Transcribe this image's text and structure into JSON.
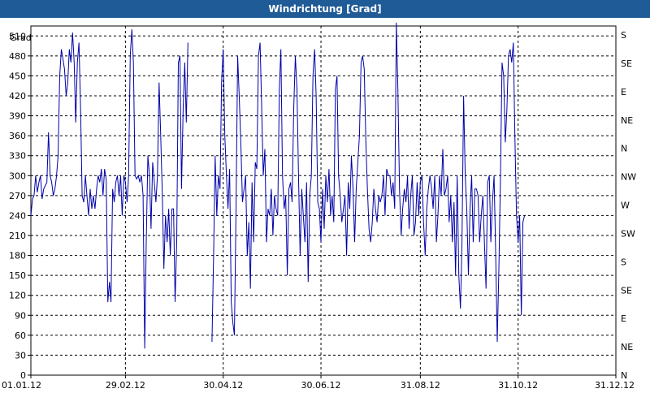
{
  "window": {
    "title": "Windrichtung [Grad]"
  },
  "chart_data": {
    "type": "line",
    "title": "Windrichtung [Grad]",
    "ylabel": "Grad",
    "xlabel": "",
    "ylim": [
      0,
      525
    ],
    "y_ticks": [
      0,
      30,
      60,
      90,
      120,
      150,
      180,
      210,
      240,
      270,
      300,
      330,
      360,
      390,
      420,
      450,
      480,
      510
    ],
    "x_ticks": [
      "01.01.12",
      "29.02.12",
      "30.04.12",
      "30.06.12",
      "31.08.12",
      "31.10.12",
      "31.12.12"
    ],
    "x_tick_days": [
      0,
      59,
      120,
      181,
      243,
      304,
      365
    ],
    "right_ticks": [
      {
        "label": "N",
        "deg": 0
      },
      {
        "label": "NE",
        "deg": 30
      },
      {
        "label": "E",
        "deg": 60
      },
      {
        "label": "SE",
        "deg": 90
      },
      {
        "label": "S",
        "deg": 120
      },
      {
        "label": "SW",
        "deg": 150
      },
      {
        "label": "W",
        "deg": 180
      },
      {
        "label": "NW",
        "deg": 210
      },
      {
        "label": "N",
        "deg": 240
      },
      {
        "label": "NE",
        "deg": 270
      },
      {
        "label": "E",
        "deg": 300
      },
      {
        "label": "SE",
        "deg": 330
      },
      {
        "label": "S",
        "deg": 360
      }
    ],
    "grid": true,
    "series": [
      {
        "name": "",
        "color": "#0000aa",
        "points": [
          [
            0,
            240
          ],
          [
            1,
            265
          ],
          [
            2,
            270
          ],
          [
            3,
            300
          ],
          [
            4,
            275
          ],
          [
            5,
            290
          ],
          [
            6,
            300
          ],
          [
            7,
            265
          ],
          [
            8,
            280
          ],
          [
            10,
            290
          ],
          [
            11,
            365
          ],
          [
            12,
            300
          ],
          [
            13,
            290
          ],
          [
            14,
            270
          ],
          [
            15,
            280
          ],
          [
            16,
            300
          ],
          [
            17,
            330
          ],
          [
            18,
            450
          ],
          [
            19,
            490
          ],
          [
            20,
            475
          ],
          [
            21,
            460
          ],
          [
            22,
            420
          ],
          [
            23,
            440
          ],
          [
            24,
            490
          ],
          [
            25,
            470
          ],
          [
            26,
            515
          ],
          [
            27,
            470
          ],
          [
            28,
            380
          ],
          [
            29,
            470
          ],
          [
            30,
            500
          ],
          [
            31,
            400
          ],
          [
            32,
            270
          ],
          [
            33,
            260
          ],
          [
            34,
            300
          ],
          [
            35,
            270
          ],
          [
            36,
            240
          ],
          [
            37,
            280
          ],
          [
            38,
            250
          ],
          [
            39,
            270
          ],
          [
            40,
            250
          ],
          [
            41,
            280
          ],
          [
            42,
            300
          ],
          [
            43,
            290
          ],
          [
            44,
            310
          ],
          [
            45,
            270
          ],
          [
            46,
            310
          ],
          [
            47,
            295
          ],
          [
            48,
            110
          ],
          [
            49,
            140
          ],
          [
            50,
            110
          ],
          [
            51,
            280
          ],
          [
            52,
            260
          ],
          [
            53,
            290
          ],
          [
            54,
            300
          ],
          [
            55,
            270
          ],
          [
            56,
            300
          ],
          [
            57,
            240
          ],
          [
            58,
            300
          ],
          [
            59,
            290
          ],
          [
            60,
            260
          ],
          [
            61,
            300
          ],
          [
            62,
            480
          ],
          [
            63,
            520
          ],
          [
            64,
            470
          ],
          [
            65,
            300
          ],
          [
            66,
            295
          ],
          [
            67,
            300
          ],
          [
            68,
            290
          ],
          [
            69,
            300
          ],
          [
            70,
            270
          ],
          [
            71,
            40
          ],
          [
            72,
            200
          ],
          [
            73,
            330
          ],
          [
            74,
            300
          ],
          [
            75,
            220
          ],
          [
            76,
            320
          ],
          [
            77,
            290
          ],
          [
            78,
            260
          ],
          [
            79,
            300
          ],
          [
            80,
            440
          ],
          [
            81,
            360
          ],
          [
            82,
            270
          ],
          [
            83,
            160
          ],
          [
            84,
            240
          ],
          [
            85,
            200
          ],
          [
            86,
            250
          ],
          [
            87,
            180
          ],
          [
            88,
            250
          ],
          [
            89,
            250
          ],
          [
            90,
            110
          ],
          [
            91,
            200
          ],
          [
            92,
            470
          ],
          [
            93,
            480
          ],
          [
            94,
            280
          ],
          [
            95,
            400
          ],
          [
            96,
            470
          ],
          [
            97,
            380
          ],
          [
            98,
            500
          ],
          [
            113,
            50
          ],
          [
            114,
            180
          ],
          [
            115,
            330
          ],
          [
            116,
            240
          ],
          [
            117,
            300
          ],
          [
            118,
            280
          ],
          [
            119,
            440
          ],
          [
            120,
            490
          ],
          [
            121,
            360
          ],
          [
            122,
            300
          ],
          [
            123,
            250
          ],
          [
            124,
            310
          ],
          [
            125,
            110
          ],
          [
            126,
            80
          ],
          [
            127,
            60
          ],
          [
            128,
            250
          ],
          [
            129,
            480
          ],
          [
            130,
            420
          ],
          [
            131,
            350
          ],
          [
            132,
            260
          ],
          [
            133,
            280
          ],
          [
            134,
            300
          ],
          [
            135,
            180
          ],
          [
            136,
            230
          ],
          [
            137,
            130
          ],
          [
            138,
            290
          ],
          [
            139,
            200
          ],
          [
            140,
            320
          ],
          [
            141,
            310
          ],
          [
            142,
            480
          ],
          [
            143,
            500
          ],
          [
            144,
            400
          ],
          [
            145,
            300
          ],
          [
            146,
            340
          ],
          [
            147,
            200
          ],
          [
            148,
            250
          ],
          [
            149,
            240
          ],
          [
            150,
            280
          ],
          [
            151,
            210
          ],
          [
            152,
            270
          ],
          [
            153,
            250
          ],
          [
            154,
            240
          ],
          [
            155,
            430
          ],
          [
            156,
            490
          ],
          [
            157,
            300
          ],
          [
            158,
            250
          ],
          [
            159,
            270
          ],
          [
            160,
            150
          ],
          [
            161,
            280
          ],
          [
            162,
            290
          ],
          [
            163,
            260
          ],
          [
            164,
            400
          ],
          [
            165,
            480
          ],
          [
            166,
            430
          ],
          [
            167,
            300
          ],
          [
            168,
            180
          ],
          [
            169,
            280
          ],
          [
            170,
            240
          ],
          [
            171,
            200
          ],
          [
            172,
            290
          ],
          [
            173,
            140
          ],
          [
            174,
            270
          ],
          [
            175,
            300
          ],
          [
            176,
            450
          ],
          [
            177,
            490
          ],
          [
            178,
            420
          ],
          [
            179,
            260
          ],
          [
            180,
            250
          ],
          [
            181,
            200
          ],
          [
            182,
            280
          ],
          [
            183,
            220
          ],
          [
            184,
            300
          ],
          [
            185,
            260
          ],
          [
            186,
            310
          ],
          [
            187,
            240
          ],
          [
            188,
            270
          ],
          [
            189,
            230
          ],
          [
            190,
            430
          ],
          [
            191,
            450
          ],
          [
            192,
            300
          ],
          [
            193,
            270
          ],
          [
            194,
            230
          ],
          [
            195,
            250
          ],
          [
            196,
            270
          ],
          [
            197,
            180
          ],
          [
            198,
            290
          ],
          [
            199,
            250
          ],
          [
            200,
            330
          ],
          [
            201,
            280
          ],
          [
            202,
            200
          ],
          [
            203,
            280
          ],
          [
            204,
            320
          ],
          [
            205,
            360
          ],
          [
            206,
            470
          ],
          [
            207,
            480
          ],
          [
            208,
            460
          ],
          [
            209,
            350
          ],
          [
            210,
            280
          ],
          [
            211,
            220
          ],
          [
            212,
            200
          ],
          [
            213,
            230
          ],
          [
            214,
            280
          ],
          [
            215,
            250
          ],
          [
            216,
            230
          ],
          [
            217,
            270
          ],
          [
            218,
            260
          ],
          [
            219,
            270
          ],
          [
            220,
            300
          ],
          [
            221,
            240
          ],
          [
            222,
            310
          ],
          [
            223,
            300
          ],
          [
            224,
            300
          ],
          [
            225,
            270
          ],
          [
            226,
            290
          ],
          [
            227,
            250
          ],
          [
            228,
            530
          ],
          [
            229,
            430
          ],
          [
            230,
            280
          ],
          [
            231,
            210
          ],
          [
            232,
            250
          ],
          [
            233,
            280
          ],
          [
            234,
            260
          ],
          [
            235,
            300
          ],
          [
            236,
            220
          ],
          [
            237,
            270
          ],
          [
            238,
            300
          ],
          [
            239,
            210
          ],
          [
            240,
            230
          ],
          [
            241,
            290
          ],
          [
            242,
            240
          ],
          [
            243,
            290
          ],
          [
            244,
            300
          ],
          [
            245,
            230
          ],
          [
            246,
            180
          ],
          [
            247,
            250
          ],
          [
            248,
            280
          ],
          [
            249,
            300
          ],
          [
            250,
            280
          ],
          [
            251,
            250
          ],
          [
            252,
            300
          ],
          [
            253,
            200
          ],
          [
            254,
            240
          ],
          [
            255,
            300
          ],
          [
            256,
            270
          ],
          [
            257,
            340
          ],
          [
            258,
            270
          ],
          [
            259,
            280
          ],
          [
            260,
            300
          ],
          [
            261,
            230
          ],
          [
            262,
            270
          ],
          [
            263,
            200
          ],
          [
            264,
            260
          ],
          [
            265,
            150
          ],
          [
            266,
            300
          ],
          [
            267,
            150
          ],
          [
            268,
            100
          ],
          [
            269,
            200
          ],
          [
            270,
            420
          ],
          [
            271,
            300
          ],
          [
            272,
            250
          ],
          [
            273,
            150
          ],
          [
            274,
            250
          ],
          [
            275,
            300
          ],
          [
            276,
            200
          ],
          [
            277,
            280
          ],
          [
            278,
            280
          ],
          [
            279,
            270
          ],
          [
            280,
            200
          ],
          [
            281,
            240
          ],
          [
            282,
            270
          ],
          [
            283,
            200
          ],
          [
            284,
            130
          ],
          [
            285,
            290
          ],
          [
            286,
            300
          ],
          [
            287,
            200
          ],
          [
            288,
            260
          ],
          [
            289,
            300
          ],
          [
            290,
            180
          ],
          [
            291,
            50
          ],
          [
            292,
            160
          ],
          [
            293,
            300
          ],
          [
            294,
            470
          ],
          [
            295,
            450
          ],
          [
            296,
            350
          ],
          [
            297,
            400
          ],
          [
            298,
            480
          ],
          [
            299,
            490
          ],
          [
            300,
            470
          ],
          [
            301,
            500
          ],
          [
            302,
            360
          ],
          [
            303,
            240
          ],
          [
            304,
            200
          ],
          [
            305,
            240
          ],
          [
            306,
            90
          ],
          [
            307,
            230
          ],
          [
            308,
            240
          ]
        ]
      }
    ]
  }
}
